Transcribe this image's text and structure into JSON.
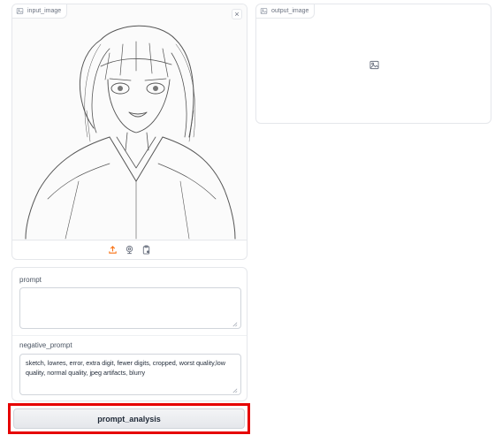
{
  "input_image": {
    "label": "input_image",
    "clear_symbol": "×",
    "source_icons": [
      "upload-icon",
      "webcam-icon",
      "clipboard-icon"
    ]
  },
  "output_image": {
    "label": "output_image",
    "placeholder_icon": "image-icon"
  },
  "prompt": {
    "label": "prompt",
    "value": ""
  },
  "negative_prompt": {
    "label": "negative_prompt",
    "value": "sketch, lowres, error, extra digit, fewer digits, cropped, worst quality,low quality, normal quality, jpeg artifacts, blurry"
  },
  "actions": {
    "analyze_label": "prompt_analysis"
  },
  "colors": {
    "highlight": "#e60000",
    "upload_icon": "#f97316"
  }
}
